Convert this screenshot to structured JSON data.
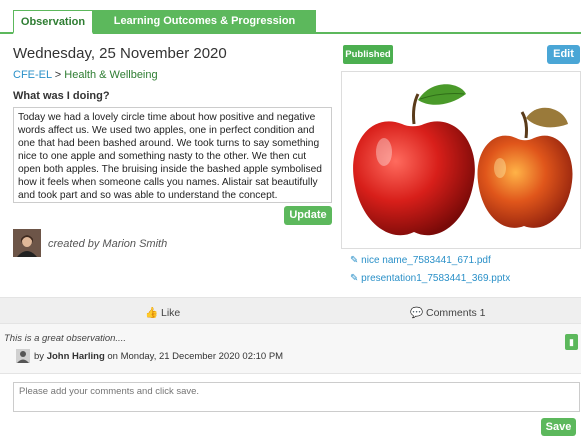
{
  "tabs": {
    "observation": "Observation",
    "outcomes": "Learning Outcomes & Progression Pathways"
  },
  "observation": {
    "date": "Wednesday, 25 November 2020",
    "curriculum": "CFE-EL",
    "separator": " > ",
    "area": "Health & Wellbeing",
    "section_label": "What was I doing?",
    "text": "Today we had a lovely circle time about how positive and negative words affect us. We used two apples, one in perfect condition and one that had been bashed around. We took turns to say something nice to one apple and something nasty to the other. We then cut open both apples. The bruising inside the bashed apple symbolised how it feels when someone calls you names. Alistair sat beautifully and took part and so was able to understand the concept.",
    "update_label": "Update",
    "creator": "created by Marion Smith"
  },
  "status": {
    "badge": "Published",
    "edit_label": "Edit"
  },
  "attachments": [
    "nice name_7583441_671.pdf",
    "presentation1_7583441_369.pptx"
  ],
  "social": {
    "like_label": "Like",
    "comments_label": "Comments 1"
  },
  "comment": {
    "text": "This is a great observation....",
    "by": "by ",
    "author": "John Harling",
    "on": " on Monday, 21 December 2020 02:10 PM"
  },
  "new_comment": {
    "placeholder": "Please add your comments and click save.",
    "save_label": "Save"
  },
  "colors": {
    "accent_green": "#5cb85c",
    "link_blue": "#2a90c8",
    "edit_blue": "#4aa6d6"
  },
  "icons": {
    "attachment": "paperclip-icon",
    "like": "thumbs-up-icon",
    "comments": "speech-bubble-icon",
    "delete": "trash-icon"
  }
}
